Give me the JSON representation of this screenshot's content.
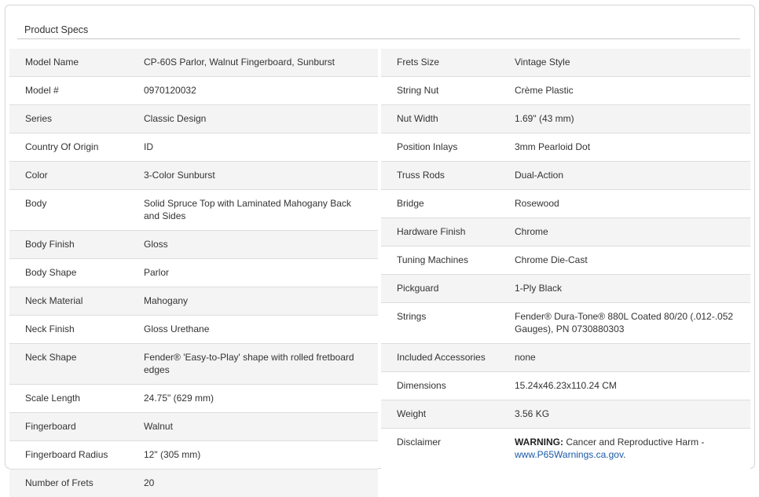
{
  "panel": {
    "title": "Product Specs"
  },
  "left_specs": [
    {
      "label": "Model Name",
      "value": "CP-60S Parlor, Walnut Fingerboard, Sunburst"
    },
    {
      "label": "Model #",
      "value": "0970120032"
    },
    {
      "label": "Series",
      "value": "Classic Design"
    },
    {
      "label": "Country Of Origin",
      "value": "ID"
    },
    {
      "label": "Color",
      "value": "3-Color Sunburst"
    },
    {
      "label": "Body",
      "value": "Solid Spruce Top with Laminated Mahogany Back and Sides"
    },
    {
      "label": "Body Finish",
      "value": "Gloss"
    },
    {
      "label": "Body Shape",
      "value": "Parlor"
    },
    {
      "label": "Neck Material",
      "value": "Mahogany"
    },
    {
      "label": "Neck Finish",
      "value": "Gloss Urethane"
    },
    {
      "label": "Neck Shape",
      "value": "Fender® 'Easy-to-Play' shape with rolled fretboard edges"
    },
    {
      "label": "Scale Length",
      "value": "24.75\" (629 mm)"
    },
    {
      "label": "Fingerboard",
      "value": "Walnut"
    },
    {
      "label": "Fingerboard Radius",
      "value": "12\" (305 mm)"
    },
    {
      "label": "Number of Frets",
      "value": "20"
    }
  ],
  "right_specs": [
    {
      "label": "Frets Size",
      "value": "Vintage Style"
    },
    {
      "label": "String Nut",
      "value": "Crème Plastic"
    },
    {
      "label": "Nut Width",
      "value": "1.69\" (43 mm)"
    },
    {
      "label": "Position Inlays",
      "value": "3mm Pearloid Dot"
    },
    {
      "label": "Truss Rods",
      "value": "Dual-Action"
    },
    {
      "label": "Bridge",
      "value": "Rosewood"
    },
    {
      "label": "Hardware Finish",
      "value": "Chrome"
    },
    {
      "label": "Tuning Machines",
      "value": "Chrome Die-Cast"
    },
    {
      "label": "Pickguard",
      "value": "1-Ply Black"
    },
    {
      "label": "Strings",
      "value": "Fender® Dura-Tone® 880L Coated 80/20 (.012-.052 Gauges), PN 0730880303"
    },
    {
      "label": "Included Accessories",
      "value": "none"
    },
    {
      "label": "Dimensions",
      "value": "15.24x46.23x110.24 CM"
    },
    {
      "label": "Weight",
      "value": "3.56 KG"
    }
  ],
  "disclaimer": {
    "label": "Disclaimer",
    "warning_label": "WARNING:",
    "warning_text": " Cancer and Reproductive Harm - ",
    "link_text": "www.P65Warnings.ca.gov",
    "link_suffix": "."
  },
  "colors": {
    "row_stripe": "#f4f4f4",
    "border": "#dddddd",
    "link": "#1a5aa8"
  }
}
